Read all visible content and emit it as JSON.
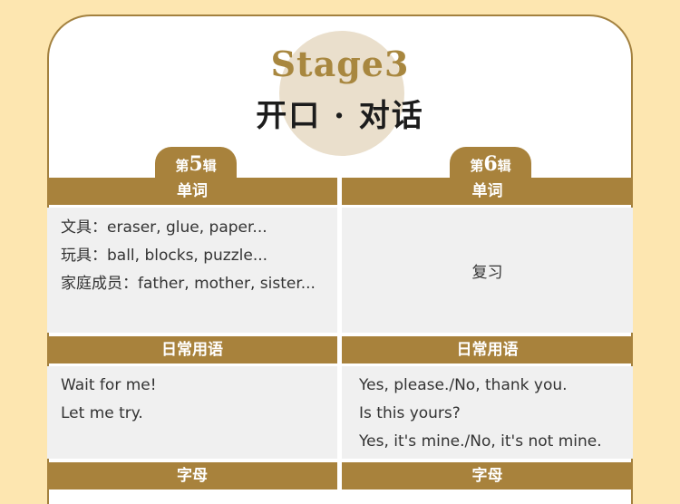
{
  "stage": {
    "title": "Stage3",
    "subtitle": "开口 · 对话"
  },
  "columns": [
    {
      "tab": {
        "prefix": "第",
        "number": "5",
        "suffix": "辑"
      },
      "sections": {
        "words_header": "单词",
        "words_lines": [
          "文具：eraser, glue, paper...",
          "玩具：ball, blocks, puzzle...",
          "家庭成员：father, mother, sister..."
        ],
        "phrases_header": "日常用语",
        "phrases_lines": [
          "Wait for me!",
          "Let me try."
        ],
        "letters_header": "字母"
      }
    },
    {
      "tab": {
        "prefix": "第",
        "number": "6",
        "suffix": "辑"
      },
      "sections": {
        "words_header": "单词",
        "words_review": "复习",
        "phrases_header": "日常用语",
        "phrases_lines": [
          "Yes, please./No, thank you.",
          "Is this yours?",
          "Yes, it's mine./No, it's not mine."
        ],
        "letters_header": "字母"
      }
    }
  ],
  "colors": {
    "background": "#fde6b0",
    "accent": "#a8823c",
    "cell": "#f0f0f0"
  }
}
